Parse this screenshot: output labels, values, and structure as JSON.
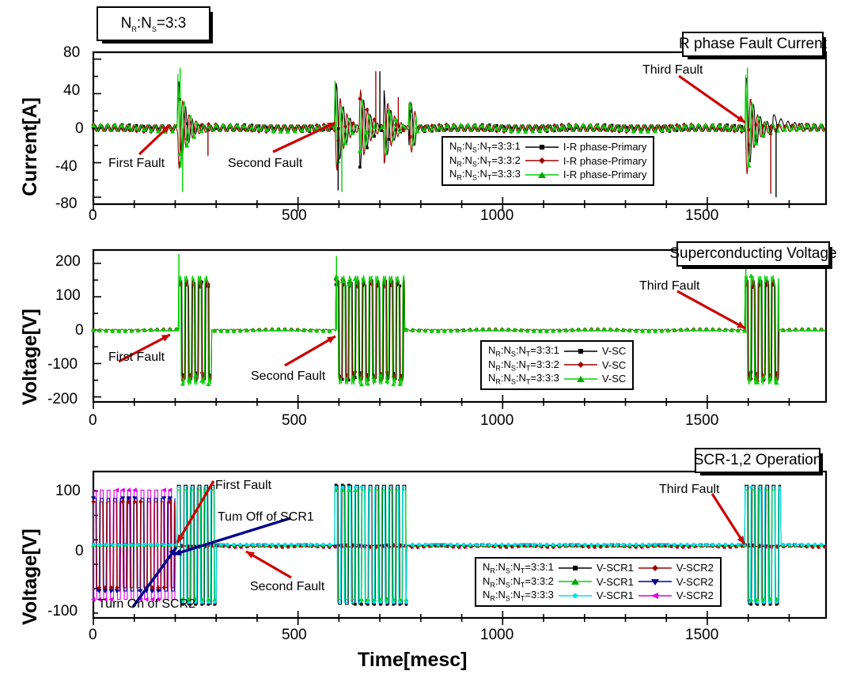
{
  "figure": {
    "corner_label": "N|R|:N|S|=3:3",
    "xlabel": "Time[mesc]"
  },
  "panels": [
    {
      "id": "panel-current",
      "title": "R phase Fault Current",
      "ylabel": "Current[A]",
      "yticks": [
        "80",
        "40",
        "0",
        "-40",
        "-80"
      ],
      "annotations": [
        "First Fault",
        "Second Fault",
        "Third Fault"
      ],
      "legend": [
        {
          "ratio": "=3:3:1",
          "label": "I-R phase-Primary",
          "color": "#000000",
          "marker": "square"
        },
        {
          "ratio": "=3:3:2",
          "label": "I-R phase-Primary",
          "color": "#9e0000",
          "marker": "diamond"
        },
        {
          "ratio": "=3:3:3",
          "label": "I-R phase-Primary",
          "color": "#00d000",
          "marker": "triangle"
        }
      ]
    },
    {
      "id": "panel-voltage-sc",
      "title": "Superconducting Voltage",
      "ylabel": "Voltage[V]",
      "yticks": [
        "200",
        "100",
        "0",
        "-100",
        "-200"
      ],
      "annotations": [
        "First Fault",
        "Second Fault",
        "Third Fault"
      ],
      "legend": [
        {
          "ratio": "=3:3:1",
          "label": "V-SC",
          "color": "#000000",
          "marker": "square"
        },
        {
          "ratio": "=3:3:2",
          "label": "V-SC",
          "color": "#9e0000",
          "marker": "diamond"
        },
        {
          "ratio": "=3:3:3",
          "label": "V-SC",
          "color": "#00d000",
          "marker": "triangle"
        }
      ]
    },
    {
      "id": "panel-scr",
      "title": "SCR-1,2 Operation",
      "ylabel": "Voltage[V]",
      "yticks": [
        "100",
        "0",
        "-100"
      ],
      "annotations": [
        "First Fault",
        "Second Fault",
        "Third Fault",
        "Tum Off of SCR1",
        "Turn On of SCR2"
      ],
      "legend": [
        {
          "ratio": "=3:3:1",
          "label1": "V-SCR1",
          "color1": "#000000",
          "marker1": "square",
          "label2": "V-SCR2",
          "color2": "#9e0000",
          "marker2": "diamond"
        },
        {
          "ratio": "=3:3:2",
          "label1": "V-SCR1",
          "color1": "#00d000",
          "marker1": "triangle",
          "label2": "V-SCR2",
          "color2": "#000090",
          "marker2": "triangle-down"
        },
        {
          "ratio": "=3:3:3",
          "label1": "V-SCR1",
          "color1": "#00ddee",
          "marker1": "circle",
          "label2": "V-SCR2",
          "color2": "#e000e0",
          "marker2": "triangle-left"
        }
      ]
    }
  ],
  "xticks": [
    "0",
    "500",
    "1000",
    "1500"
  ],
  "chart_data": {
    "type": "line",
    "title": "R phase Fault Current / Superconducting Voltage / SCR-1,2 Operation",
    "xlabel": "Time[mesc]",
    "xlim": [
      0,
      1790
    ],
    "xticks": [
      0,
      500,
      1000,
      1500
    ],
    "fault_events": [
      {
        "name": "First Fault",
        "time": 205
      },
      {
        "name": "Second Fault",
        "time": 595
      },
      {
        "name": "Third Fault",
        "time": 1595
      }
    ],
    "subplots": [
      {
        "name": "R phase Fault Current",
        "ylabel": "Current[A]",
        "ylim": [
          -80,
          80
        ],
        "yticks": [
          -80,
          -40,
          0,
          40,
          80
        ],
        "series": [
          {
            "name": "I-R phase-Primary",
            "ratio": "N_R:N_S:N_T=3:3:1",
            "color": "#000000",
            "peaks": [
              {
                "t": 212,
                "v": 70
              },
              {
                "t": 218,
                "v": -72
              },
              {
                "t": 600,
                "v": 62
              },
              {
                "t": 607,
                "v": -70
              },
              {
                "t": 700,
                "v": 65
              },
              {
                "t": 745,
                "v": 35
              },
              {
                "t": 1600,
                "v": 68
              },
              {
                "t": 1660,
                "v": -72
              }
            ],
            "steady_amplitude": 4
          },
          {
            "name": "I-R phase-Primary",
            "ratio": "N_R:N_S:N_T=3:3:2",
            "color": "#9e0000",
            "peaks": [
              {
                "t": 214,
                "v": 55
              },
              {
                "t": 280,
                "v": -30
              },
              {
                "t": 690,
                "v": 66
              },
              {
                "t": 735,
                "v": 60
              },
              {
                "t": 1602,
                "v": 62
              },
              {
                "t": 1655,
                "v": -75
              }
            ],
            "steady_amplitude": 4
          },
          {
            "name": "I-R phase-Primary",
            "ratio": "N_R:N_S:N_T=3:3:3",
            "color": "#00d000",
            "peaks": [
              {
                "t": 210,
                "v": 70
              },
              {
                "t": 216,
                "v": -72
              },
              {
                "t": 598,
                "v": 55
              },
              {
                "t": 605,
                "v": -68
              },
              {
                "t": 1598,
                "v": 68
              },
              {
                "t": 1610,
                "v": -35
              }
            ],
            "steady_amplitude": 4
          }
        ],
        "burst_windows": [
          [
            205,
            300
          ],
          [
            590,
            790
          ],
          [
            1592,
            1680
          ]
        ]
      },
      {
        "name": "Superconducting Voltage",
        "ylabel": "Voltage[V]",
        "ylim": [
          -200,
          230
        ],
        "yticks": [
          -200,
          -100,
          0,
          100,
          200
        ],
        "series": [
          {
            "name": "V-SC",
            "ratio": "N_R:N_S:N_T=3:3:1",
            "color": "#000000",
            "burst_amplitude": 150
          },
          {
            "name": "V-SC",
            "ratio": "N_R:N_S:N_T=3:3:2",
            "color": "#9e0000",
            "burst_amplitude": 150
          },
          {
            "name": "V-SC",
            "ratio": "N_R:N_S:N_T=3:3:3",
            "color": "#00d000",
            "burst_amplitude": 165
          }
        ],
        "burst_windows": [
          [
            208,
            288
          ],
          [
            592,
            760
          ],
          [
            1592,
            1675
          ]
        ],
        "peak_spike": 225
      },
      {
        "name": "SCR-1,2 Operation",
        "ylabel": "Voltage[V]",
        "ylim": [
          -140,
          140
        ],
        "yticks": [
          -100,
          0,
          100
        ],
        "series": [
          {
            "name": "V-SCR1",
            "ratio": "N_R:N_S:N_T=3:3:1",
            "color": "#000000",
            "burst_amplitude": 120
          },
          {
            "name": "V-SCR2",
            "ratio": "N_R:N_S:N_T=3:3:1",
            "color": "#9e0000",
            "burst_amplitude": 95
          },
          {
            "name": "V-SCR1",
            "ratio": "N_R:N_S:N_T=3:3:2",
            "color": "#00d000",
            "burst_amplitude": 110
          },
          {
            "name": "V-SCR2",
            "ratio": "N_R:N_S:N_T=3:3:2",
            "color": "#000090",
            "burst_amplitude": 95
          },
          {
            "name": "V-SCR1",
            "ratio": "N_R:N_S:N_T=3:3:3",
            "color": "#00ddee",
            "burst_amplitude": 115
          },
          {
            "name": "V-SCR2",
            "ratio": "N_R:N_S:N_T=3:3:3",
            "color": "#e000e0",
            "burst_amplitude": 100
          }
        ],
        "scr2_on_window": [
          0,
          200
        ],
        "burst_windows": [
          [
            205,
            300
          ],
          [
            590,
            765
          ],
          [
            1592,
            1680
          ]
        ]
      }
    ]
  }
}
